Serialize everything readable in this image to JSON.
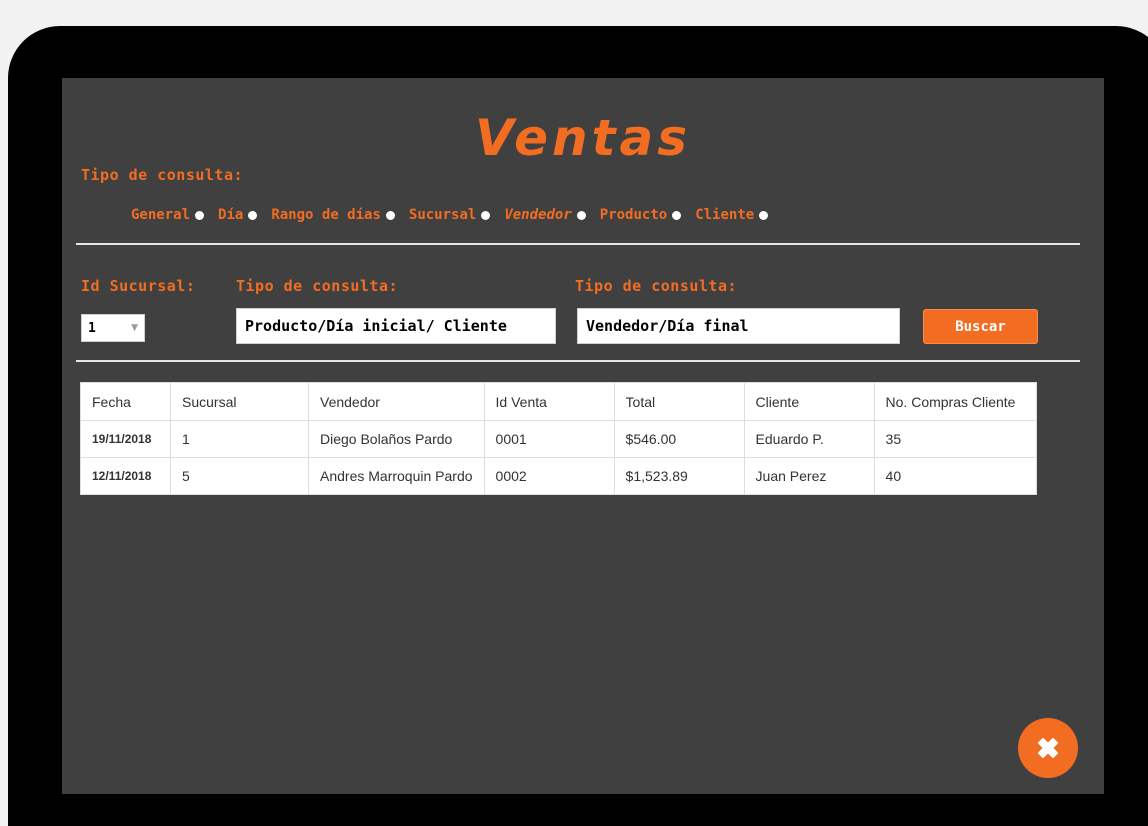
{
  "page": {
    "title": "Ventas"
  },
  "query_type": {
    "label": "Tipo de consulta:",
    "options": [
      {
        "label": "General"
      },
      {
        "label": "Día"
      },
      {
        "label": "Rango de días"
      },
      {
        "label": "Sucursal"
      },
      {
        "label": "Vendedor"
      },
      {
        "label": "Producto"
      },
      {
        "label": "Cliente"
      }
    ]
  },
  "filters": {
    "branch_label": "Id Sucursal:",
    "branch_value": "1",
    "query_label_2": "Tipo de consulta:",
    "query_input_2": "Producto/Día inicial/ Cliente",
    "query_label_3": "Tipo de consulta:",
    "query_input_3": "Vendedor/Día final",
    "search_label": "Buscar"
  },
  "table": {
    "headers": [
      "Fecha",
      "Sucursal",
      "Vendedor",
      "Id Venta",
      "Total",
      "Cliente",
      "No. Compras Cliente"
    ],
    "rows": [
      [
        "19/11/2018",
        "1",
        "Diego Bolaños Pardo",
        "0001",
        "$546.00",
        "Eduardo P.",
        "35"
      ],
      [
        "12/11/2018",
        "5",
        "Andres Marroquin Pardo",
        "0002",
        "$1,523.89",
        "Juan Perez",
        "40"
      ]
    ]
  },
  "colors": {
    "accent": "#f26d21",
    "screen_bg": "#404040",
    "frame": "#000000"
  },
  "icons": {
    "close": "close-icon",
    "dropdown": "chevron-down-icon"
  }
}
